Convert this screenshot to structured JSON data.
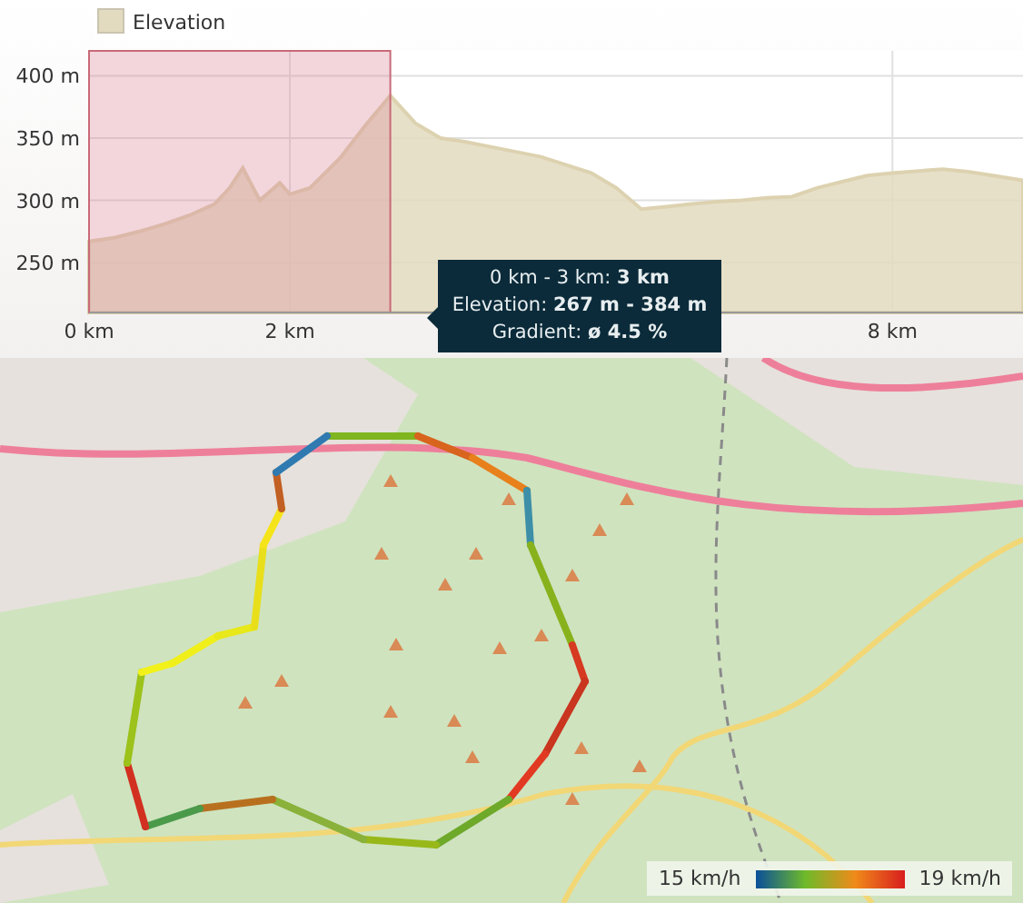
{
  "elevation_chart": {
    "chart_data": {
      "type": "area",
      "series": [
        {
          "name": "Elevation",
          "color": "#e3dbbf",
          "values": [
            267,
            270,
            275,
            281,
            288,
            297,
            310,
            326,
            300,
            314,
            305,
            310,
            334,
            360,
            384,
            362,
            350,
            347,
            343,
            335,
            322,
            310,
            293,
            295,
            297,
            299,
            300,
            302,
            303,
            310,
            315,
            320,
            322,
            325,
            323,
            320,
            316
          ]
        }
      ],
      "x": [
        0,
        0.25,
        0.5,
        0.75,
        1,
        1.25,
        1.4,
        1.53,
        1.7,
        1.9,
        2,
        2.2,
        2.5,
        2.75,
        3,
        3.25,
        3.5,
        3.75,
        4,
        4.5,
        5,
        5.25,
        5.5,
        5.75,
        6,
        6.25,
        6.5,
        6.75,
        7,
        7.25,
        7.5,
        7.75,
        8,
        8.5,
        8.75,
        9,
        9.3
      ],
      "xlim": [
        0,
        9.3
      ],
      "ylim": [
        210,
        420
      ],
      "xticks": [
        {
          "value": 0,
          "label": "0 km"
        },
        {
          "value": 2,
          "label": "2 km"
        },
        {
          "value": 8,
          "label": "8 km"
        }
      ],
      "yticks": [
        {
          "value": 250,
          "label": "250 m"
        },
        {
          "value": 300,
          "label": "300 m"
        },
        {
          "value": 350,
          "label": "350 m"
        },
        {
          "value": 400,
          "label": "400 m"
        }
      ],
      "grid": true,
      "bands": [
        {
          "axis": "x",
          "from": 0,
          "to": 3,
          "color": "#d98a9a"
        }
      ]
    },
    "tooltip": [
      "0 km - 3 km: **3 km**",
      "Elevation: **267 m - 384 m**",
      "Gradient: **ø 4.5 %**"
    ]
  },
  "map": {
    "speed_legend": {
      "min": "15 km/h",
      "max": "19 km/h"
    }
  }
}
